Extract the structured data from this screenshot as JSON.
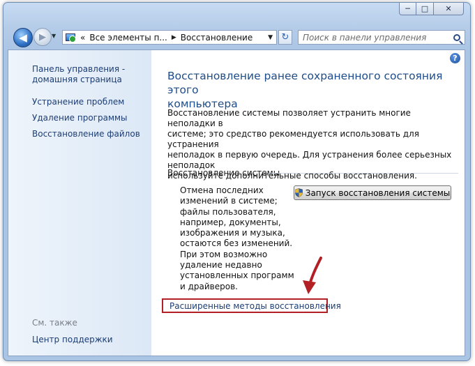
{
  "window": {
    "caption_buttons": {
      "minimize": "─",
      "maximize": "□",
      "close": "✕"
    }
  },
  "navbar": {
    "back_glyph": "◀",
    "forward_glyph": "▶",
    "history_drop": "▼",
    "address": {
      "prefix": "«",
      "segments": [
        "Все элементы п...",
        "Восстановление"
      ],
      "separator": "▶",
      "drop": "▼"
    },
    "refresh_glyph": "↻",
    "search": {
      "placeholder": "Поиск в панели управления"
    }
  },
  "help": {
    "glyph": "?"
  },
  "sidebar": {
    "home_link": [
      "Панель управления -",
      "домашняя страница"
    ],
    "items": [
      {
        "label": "Устранение проблем"
      },
      {
        "label": "Удаление программы"
      },
      {
        "label": "Восстановление файлов"
      }
    ],
    "see_also": "См. также",
    "support_link": "Центр поддержки"
  },
  "main": {
    "title_lines": [
      "Восстановление ранее сохраненного состояния этого",
      "компьютера"
    ],
    "description_lines": [
      "Восстановление системы позволяет устранить многие неполадки в",
      "системе; это средство рекомендуется использовать для устранения",
      "неполадок в первую очередь. Для устранения более серьезных неполадок",
      "используйте дополнительные способы восстановления."
    ],
    "section": {
      "title": "Восстановление системы",
      "text_lines": [
        "Отмена последних",
        "изменений в системе;",
        "файлы пользователя,",
        "например, документы,",
        "изображения и музыка,",
        "остаются без изменений.",
        "При этом возможно",
        "удаление недавно",
        "установленных программ",
        "и драйверов."
      ],
      "button_label": "Запуск восстановления системы"
    },
    "advanced_link": "Расширенные методы восстановления"
  },
  "colors": {
    "link": "#1b3d76",
    "title": "#1e4c8a",
    "annotation_red": "#b21f24"
  }
}
